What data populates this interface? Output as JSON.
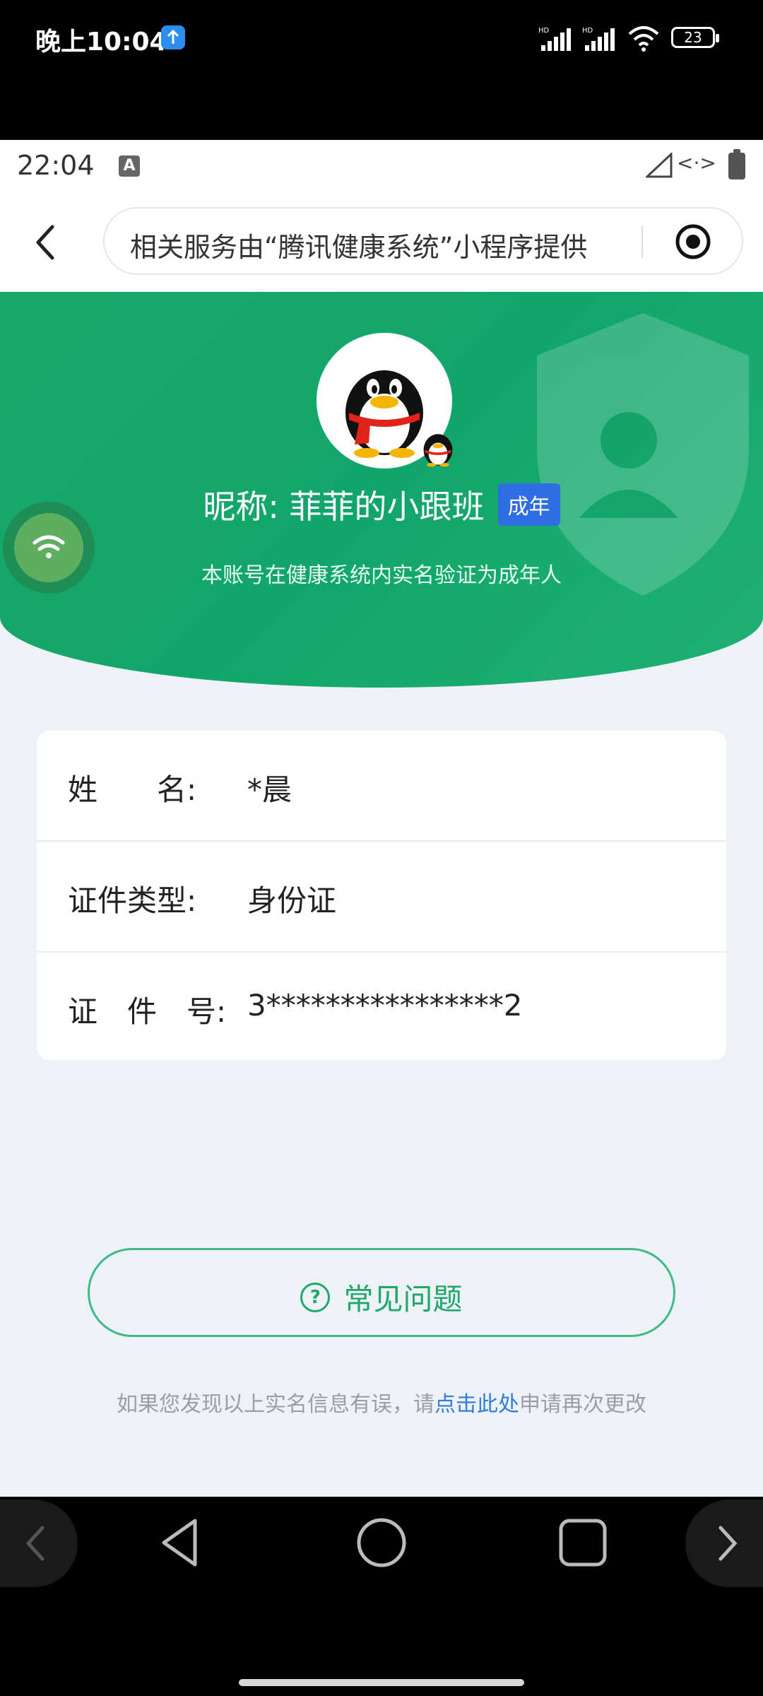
{
  "outer_status": {
    "time": "晚上10:04",
    "battery_level": "23"
  },
  "inner_status": {
    "time": "22:04",
    "keyboard_indicator": "A",
    "link_icon_text": "<·>"
  },
  "navbar": {
    "notice": "相关服务由“腾讯健康系统”小程序提供"
  },
  "profile": {
    "nickname": "昵称: 菲菲的小跟班",
    "badge": "成年",
    "description": "本账号在健康系统内实名验证为成年人"
  },
  "info": {
    "rows": [
      {
        "label": "姓　　名:",
        "value": "*晨"
      },
      {
        "label": "证件类型:",
        "value": "身份证"
      },
      {
        "label": "证　件　号:",
        "value": "3****************2"
      }
    ]
  },
  "faq": {
    "icon_glyph": "?",
    "label": "常见问题"
  },
  "footer": {
    "prefix": "如果您发现以上实名信息有误，请",
    "link": "点击此处",
    "suffix": "申请再次更改"
  },
  "colors": {
    "brand_green": "#12a56b",
    "badge_blue": "#2f6de4",
    "link_blue": "#2f7de1"
  },
  "icons": [
    "upload-icon",
    "signal-icon",
    "wifi-icon",
    "battery-icon",
    "back-icon",
    "target-icon",
    "shield-icon",
    "qq-penguin-icon",
    "wifi-float-icon",
    "question-icon",
    "nav-back-icon",
    "nav-home-icon",
    "nav-recents-icon",
    "chevron-left-icon",
    "chevron-right-icon"
  ]
}
